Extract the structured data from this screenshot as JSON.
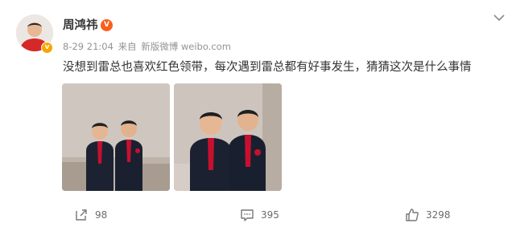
{
  "post": {
    "author": "周鸿祎",
    "vip_badge_glyph": "V",
    "verify_badge_glyph": "v",
    "date": "8-29 21:04",
    "source_prefix": "来自",
    "source": "新版微博 weibo.com",
    "text": "没想到雷总也喜欢红色领带，每次遇到雷总都有好事发生，猜猜这次是什么事情",
    "more_icon": "chevron-down-icon",
    "images": [
      {
        "icon": "photo-two-men-wide"
      },
      {
        "icon": "photo-two-men-close"
      }
    ]
  },
  "actions": {
    "repost_count": "98",
    "comment_count": "395",
    "like_count": "3298"
  },
  "colors": {
    "text": "#333333",
    "meta": "#939393",
    "badge_orange": "#f7a600",
    "vip_red": "#f75f1c",
    "tie_red": "#c8102e"
  }
}
